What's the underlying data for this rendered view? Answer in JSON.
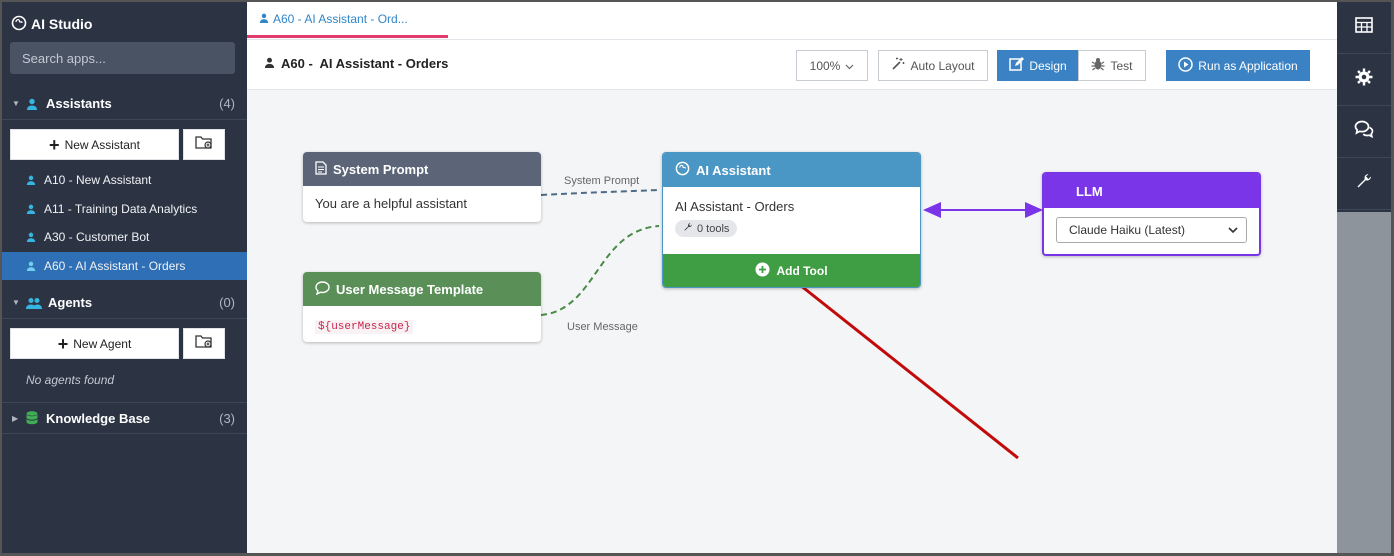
{
  "app": {
    "title": "AI Studio"
  },
  "search": {
    "placeholder": "Search apps..."
  },
  "sections": {
    "assistants": {
      "label": "Assistants",
      "count": "(4)",
      "new_button": "New Assistant",
      "items": [
        {
          "label": "A10 - New Assistant"
        },
        {
          "label": "A11 - Training Data Analytics"
        },
        {
          "label": "A30 - Customer Bot"
        },
        {
          "label": "A60 - AI Assistant - Orders"
        }
      ]
    },
    "agents": {
      "label": "Agents",
      "count": "(0)",
      "new_button": "New Agent",
      "empty_text": "No agents found"
    },
    "knowledge": {
      "label": "Knowledge Base",
      "count": "(3)"
    }
  },
  "tab": {
    "label": "A60 - AI Assistant - Ord..."
  },
  "toolbar": {
    "title": "A60 -  AI Assistant - Orders",
    "zoom": "100%",
    "auto_layout": "Auto Layout",
    "design": "Design",
    "test": "Test",
    "run": "Run as Application"
  },
  "nodes": {
    "system_prompt": {
      "title": "System Prompt",
      "body": "You are a helpful assistant"
    },
    "user_template": {
      "title": "User Message Template",
      "body": "${userMessage}"
    },
    "assistant": {
      "title": "AI Assistant",
      "name": "AI Assistant - Orders",
      "tools_badge": "0 tools",
      "add_tool": "Add Tool"
    },
    "llm": {
      "title": "LLM",
      "model": "Claude Haiku (Latest)"
    }
  },
  "edges": {
    "system_prompt_label": "System Prompt",
    "user_message_label": "User Message"
  },
  "colors": {
    "sidebar_bg": "#2c3444",
    "active_item": "#2f6fb5",
    "accent_blue": "#3b82c4",
    "system_prompt_head": "#5b6577",
    "user_template_head": "#5a8f58",
    "assistant_head": "#4a96c4",
    "add_tool_green": "#3f9e43",
    "llm_purple": "#7b35e8",
    "annotation_arrow": "#c20a0a"
  },
  "rail_icons": [
    "table-icon",
    "gear-icon",
    "chat-icon",
    "wrench-icon"
  ]
}
